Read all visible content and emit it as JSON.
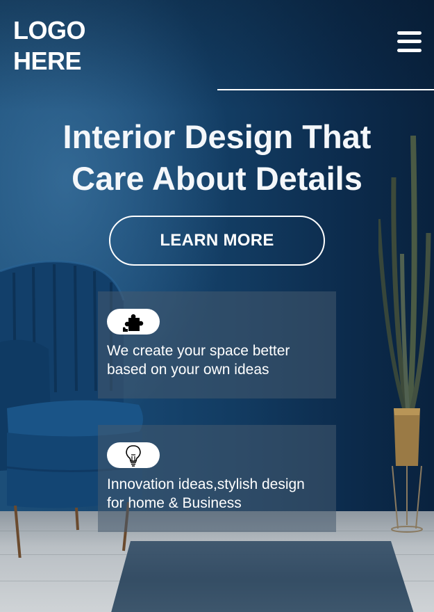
{
  "header": {
    "logo_line1": "LOGO",
    "logo_line2": "HERE",
    "menu_icon": "hamburger-menu-icon"
  },
  "hero": {
    "title_line1": "Interior Design That",
    "title_line2": "Care About Details",
    "cta_label": "LEARN MORE"
  },
  "features": [
    {
      "icon": "puzzle-icon",
      "line1": "We create your space better",
      "line2": "based on your own ideas"
    },
    {
      "icon": "lightbulb-icon",
      "line1": "Innovation ideas,stylish design",
      "line2": "for home & Business"
    }
  ],
  "colors": {
    "wall_dark": "#0c2b4c",
    "wall_light": "#1c4e78",
    "text": "#ffffff",
    "card_overlay": "rgba(70,90,110,0.55)"
  }
}
